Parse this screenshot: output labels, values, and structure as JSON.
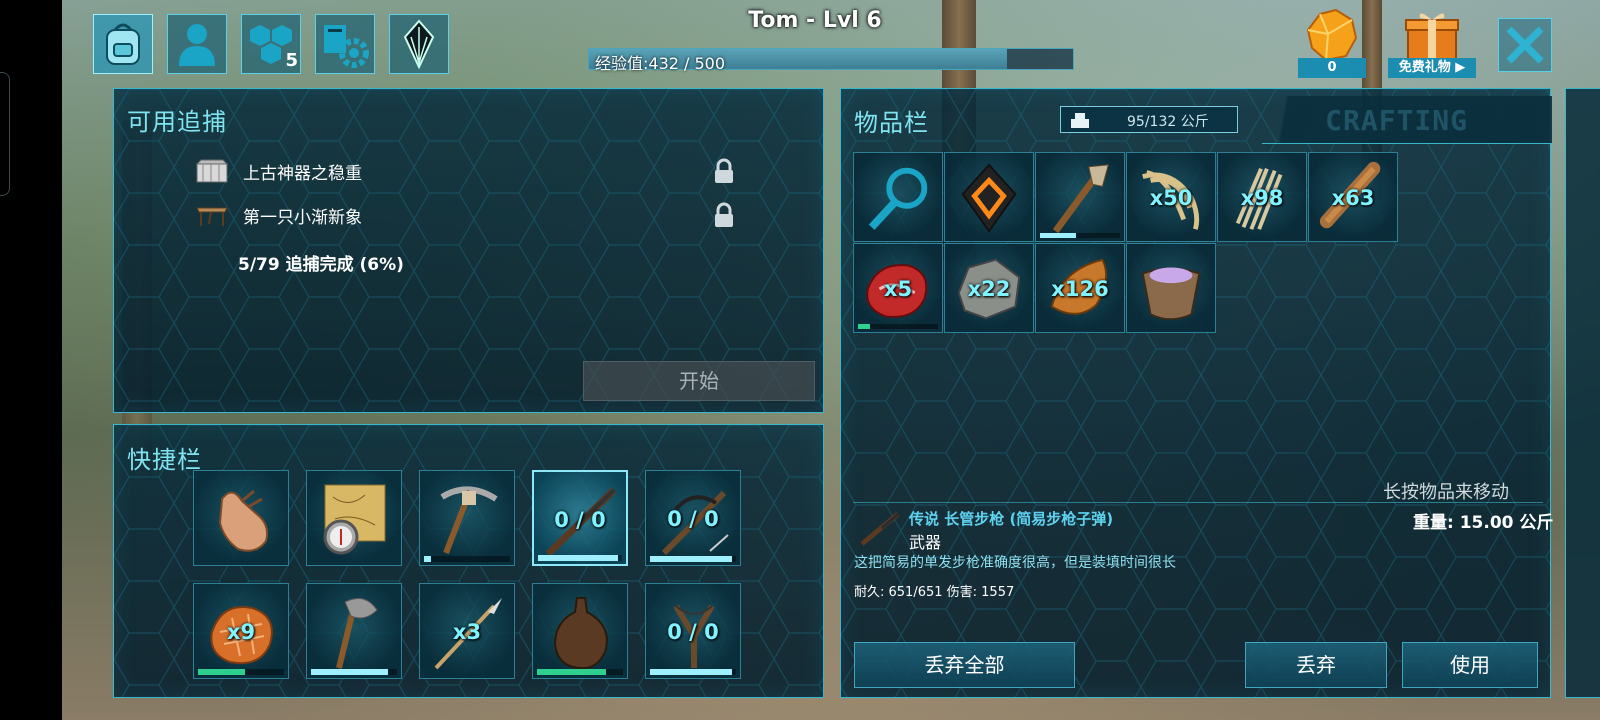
{
  "player": {
    "title": "Tom - Lvl 6",
    "xp_text": "经验值:432 / 500",
    "xp_fraction": 0.864
  },
  "top_tabs": [
    {
      "icon": "backpack-icon",
      "active": true
    },
    {
      "icon": "character-icon",
      "active": false
    },
    {
      "icon": "engrams-icon",
      "badge": "5",
      "active": false
    },
    {
      "icon": "tribe-settings-icon",
      "active": false
    },
    {
      "icon": "obelisk-icon",
      "active": false
    }
  ],
  "currency": {
    "amount": "0",
    "gift_label": "免费礼物"
  },
  "quests": {
    "title": "可用追捕",
    "items": [
      {
        "label": "上古神器之稳重",
        "icon": "chest-icon",
        "locked": true
      },
      {
        "label": "第一只小渐新象",
        "icon": "table-icon",
        "locked": true
      }
    ],
    "progress": "5/79 追捕完成 (6%)",
    "start_label": "开始"
  },
  "hotbar": {
    "title": "快捷栏",
    "slots": [
      {
        "icon": "hand-icon",
        "qty": "",
        "durability": null,
        "selected": false
      },
      {
        "icon": "map-compass-icon",
        "qty": "",
        "durability": null,
        "selected": false
      },
      {
        "icon": "pickaxe-icon",
        "qty": "",
        "durability": 0.08,
        "selected": false
      },
      {
        "icon": "long-rifle-icon",
        "qty": "0 / 0",
        "durability": 0.95,
        "selected": true
      },
      {
        "icon": "crossbow-icon",
        "qty": "0 / 0",
        "durability": 0.95,
        "selected": false
      },
      {
        "icon": "cooked-meat-icon",
        "qty": "x9",
        "durability": 0.55,
        "durability_color": "#2fd08f",
        "selected": false
      },
      {
        "icon": "stone-hatchet-icon",
        "qty": "",
        "durability": 0.9,
        "selected": false
      },
      {
        "icon": "spear-icon",
        "qty": "x3",
        "durability": null,
        "selected": false
      },
      {
        "icon": "waterskin-icon",
        "qty": "",
        "durability": 0.8,
        "durability_color": "#2fd08f",
        "selected": false
      },
      {
        "icon": "slingshot-icon",
        "qty": "0 / 0",
        "durability": 0.95,
        "selected": false
      }
    ]
  },
  "inventory": {
    "title": "物品栏",
    "weight": "95/132 公斤",
    "crafting_tab": "CRAFTING",
    "hint": "长按物品来移动",
    "slots": [
      {
        "icon": "search-icon",
        "qty": ""
      },
      {
        "icon": "implant-icon",
        "qty": ""
      },
      {
        "icon": "torch-icon",
        "qty": "",
        "durability": 0.45,
        "durability_color": "#9ff0ff"
      },
      {
        "icon": "fiber-icon",
        "qty": "x50"
      },
      {
        "icon": "thatch-icon",
        "qty": "x98"
      },
      {
        "icon": "wood-icon",
        "qty": "x63"
      },
      {
        "icon": "raw-meat-icon",
        "qty": "x5",
        "durability": 0.15,
        "durability_color": "#2fd08f"
      },
      {
        "icon": "stone-icon",
        "qty": "x22"
      },
      {
        "icon": "flint-icon",
        "qty": "x126"
      },
      {
        "icon": "mortar-icon",
        "qty": ""
      }
    ],
    "selected_item": {
      "name": "传说 长管步枪 (简易步枪子弹)",
      "category": "武器",
      "weight_label": "重量: 15.00 公斤",
      "description": "这把简易的单发步枪准确度很高，但是装填时间很长",
      "stats": "耐久: 651/651  伤害: 1557"
    },
    "drop_all_label": "丢弃全部",
    "drop_label": "丢弃",
    "use_label": "使用"
  },
  "colors": {
    "accent": "#3bb6cf",
    "title": "#7fe3f0",
    "qty": "#7ff3ff",
    "legendary": "#5fd2f0"
  }
}
